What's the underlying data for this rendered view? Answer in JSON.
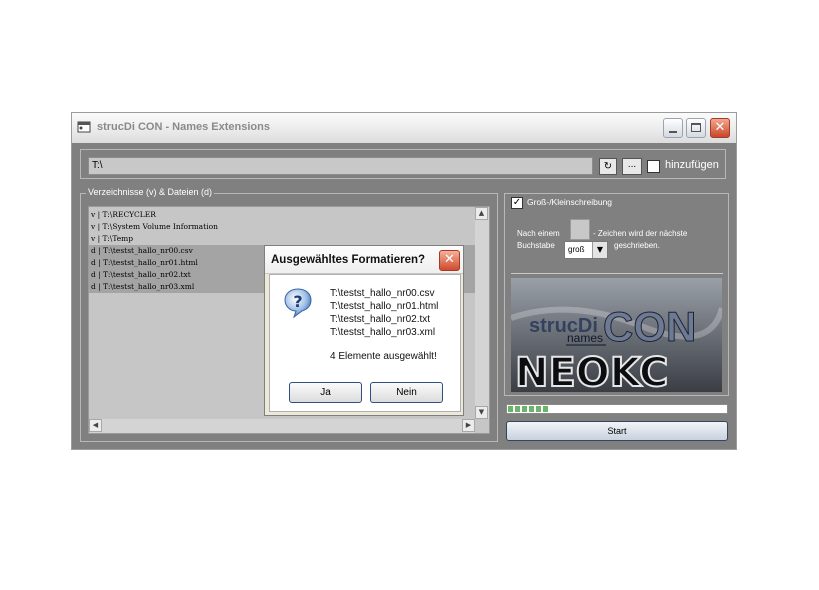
{
  "window": {
    "title": "strucDi CON - Names Extensions",
    "title_icon": "app-window-icon"
  },
  "path_bar": {
    "path_value": "T:\\",
    "refresh_glyph": "↻",
    "browse_label": "...",
    "add_label": "hinzufügen",
    "add_checked": false
  },
  "directories": {
    "group_label": "Verzeichnisse (v)  &  Dateien (d)",
    "items": [
      {
        "text": "v | T:\\RECYCLER",
        "selected": false
      },
      {
        "text": "v | T:\\System Volume Information",
        "selected": false
      },
      {
        "text": "v | T:\\Temp",
        "selected": false
      },
      {
        "text": "d | T:\\testst_hallo_nr00.csv",
        "selected": true
      },
      {
        "text": "d | T:\\testst_hallo_nr01.html",
        "selected": true
      },
      {
        "text": "d | T:\\testst_hallo_nr02.txt",
        "selected": true
      },
      {
        "text": "d | T:\\testst_hallo_nr03.xml",
        "selected": true
      }
    ]
  },
  "options": {
    "case_label": "Groß-/Kleinschreibung",
    "case_checked": true,
    "after_label": "Nach einem",
    "char_value": "",
    "next_label": "- Zeichen wird der nächste",
    "letter_label": "Buchstabe",
    "case_select_value": "groß",
    "written_label": "geschrieben."
  },
  "logo": {
    "line1": "strucDi",
    "line2": "names",
    "line3": "CON",
    "line4": "NEOKC"
  },
  "progress": {
    "fraction": 0.19
  },
  "start_label": "Start",
  "dialog": {
    "title": "Ausgewähltes Formatieren?",
    "icon": "question-icon",
    "files": [
      "T:\\testst_hallo_nr00.csv",
      "T:\\testst_hallo_nr01.html",
      "T:\\testst_hallo_nr02.txt",
      "T:\\testst_hallo_nr03.xml"
    ],
    "count_text": "4 Elemente ausgewählt!",
    "yes_label": "Ja",
    "no_label": "Nein"
  },
  "colors": {
    "window_bg": "#808080",
    "list_bg": "#c6c6c6",
    "selection": "#a4a4a4",
    "progress": "#6db36b",
    "close_button": "#d04a2d"
  }
}
